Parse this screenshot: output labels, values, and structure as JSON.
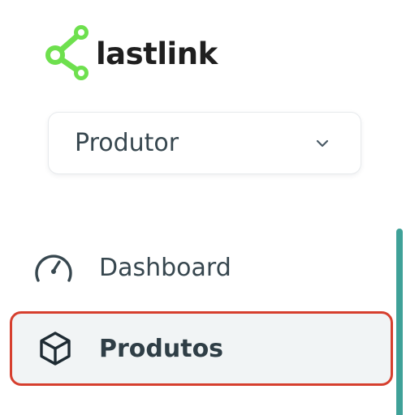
{
  "brand": {
    "name": "lastlink",
    "logo_color": "#6ee04e",
    "logo_icon": "network-nodes-icon"
  },
  "role_selector": {
    "value": "Produtor",
    "icon": "chevron-down-icon"
  },
  "nav": {
    "items": [
      {
        "label": "Dashboard",
        "icon": "gauge-icon",
        "active": false
      },
      {
        "label": "Produtos",
        "icon": "cube-icon",
        "active": true
      }
    ]
  },
  "colors": {
    "text": "#37474f",
    "active_background": "#f1f4f5",
    "active_outline": "#d63f2e",
    "scrollbar": "#3fa198"
  }
}
